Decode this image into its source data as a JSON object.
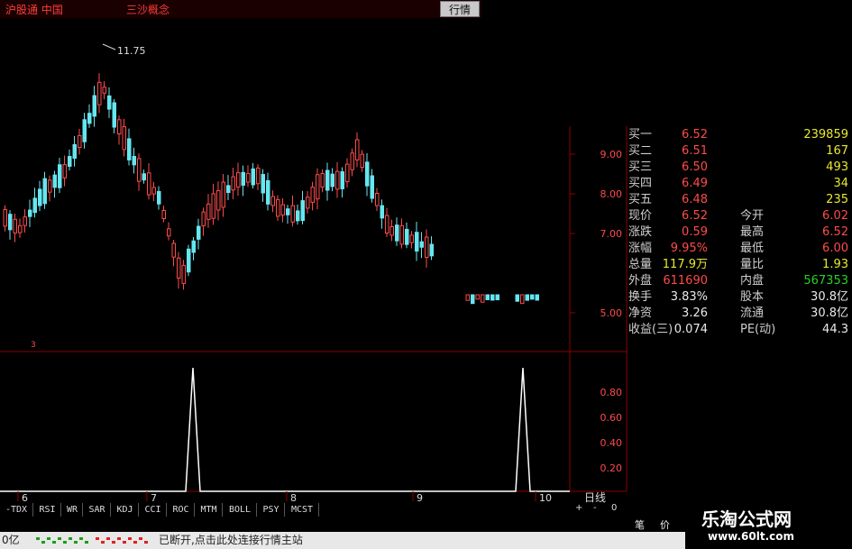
{
  "header": {
    "title": "沪股通 中国",
    "sub_title": "三沙概念",
    "tab_quote": "行情"
  },
  "chart_data": {
    "type": "candlestick",
    "annotations": {
      "high_label": "11.75",
      "marker_label": "3"
    },
    "price_axis": {
      "ticks": [
        "9.00",
        "8.00",
        "7.00",
        "5.00"
      ],
      "ylim": [
        4.5,
        12.0
      ]
    },
    "indicator_axis": {
      "ticks": [
        "0.80",
        "0.60",
        "0.40",
        "0.20"
      ]
    },
    "x_ticks": [
      "6",
      "7",
      "8",
      "9",
      "10"
    ],
    "period_label": "日线"
  },
  "quote": {
    "bids": [
      {
        "label": "买一",
        "price": "6.52",
        "vol": "239859"
      },
      {
        "label": "买二",
        "price": "6.51",
        "vol": "167"
      },
      {
        "label": "买三",
        "price": "6.50",
        "vol": "493"
      },
      {
        "label": "买四",
        "price": "6.49",
        "vol": "34"
      },
      {
        "label": "买五",
        "price": "6.48",
        "vol": "235"
      }
    ],
    "rows": [
      {
        "l1": "现价",
        "v1": "6.52",
        "l2": "今开",
        "v2": "6.02"
      },
      {
        "l1": "涨跌",
        "v1": "0.59",
        "l2": "最高",
        "v2": "6.52"
      },
      {
        "l1": "涨幅",
        "v1": "9.95%",
        "l2": "最低",
        "v2": "6.00"
      },
      {
        "l1": "总量",
        "v1": "117.9万",
        "l2": "量比",
        "v2": "1.93"
      },
      {
        "l1": "外盘",
        "v1": "611690",
        "l2": "内盘",
        "v2": "567353"
      },
      {
        "l1": "换手",
        "v1": "3.83%",
        "l2": "股本",
        "v2": "30.8亿"
      },
      {
        "l1": "净资",
        "v1": "3.26",
        "l2": "流通",
        "v2": "30.8亿"
      },
      {
        "l1": "收益(三)",
        "v1": "0.074",
        "l2": "PE(动)",
        "v2": "44.3"
      }
    ]
  },
  "indicator_tabs": [
    "-TDX",
    "RSI",
    "WR",
    "SAR",
    "KDJ",
    "CCI",
    "ROC",
    "MTM",
    "BOLL",
    "PSY",
    "MCST"
  ],
  "controls": {
    "plus": "+",
    "minus": "-",
    "zero": "0"
  },
  "side_tabs": {
    "a": "笔",
    "b": "价"
  },
  "status": {
    "left": "0亿",
    "message": "已断开,点击此处连接行情主站"
  },
  "watermark": {
    "name": "乐淘公式网",
    "url": "www.60lt.com"
  },
  "colors": {
    "up": "#ff4a4a",
    "down": "#66e6f0",
    "grid": "#8a0000"
  }
}
